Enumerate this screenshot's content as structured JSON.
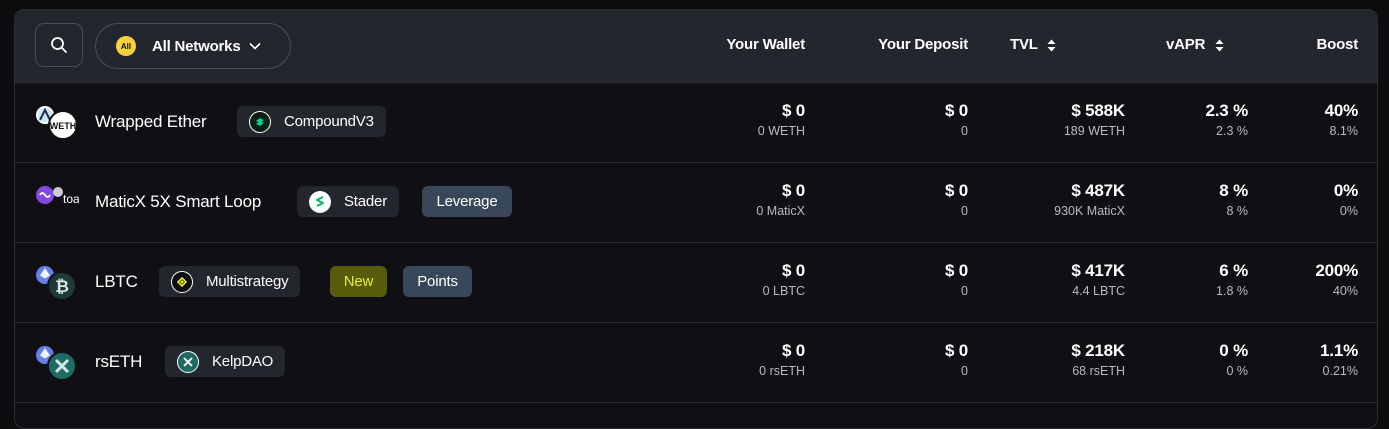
{
  "header": {
    "network_badge": "All",
    "network_label": "All Networks",
    "columns": {
      "wallet": "Your Wallet",
      "deposit": "Your Deposit",
      "tvl": "TVL",
      "vapr": "vAPR",
      "boost": "Boost"
    }
  },
  "rows": [
    {
      "name": "Wrapped Ether",
      "protocol": "CompoundV3",
      "token_badge": "WETH",
      "wallet_usd": "$ 0",
      "wallet_amt": "0 WETH",
      "deposit_usd": "$ 0",
      "deposit_amt": "0",
      "tvl_usd": "$ 588K",
      "tvl_amt": "189 WETH",
      "vapr": "2.3 %",
      "vapr_sub": "2.3 %",
      "boost": "40%",
      "boost_sub": "8.1%"
    },
    {
      "name": "MaticX 5X Smart Loop",
      "protocol": "Stader",
      "tag": "Leverage",
      "token_badge": "toa",
      "wallet_usd": "$ 0",
      "wallet_amt": "0 MaticX",
      "deposit_usd": "$ 0",
      "deposit_amt": "0",
      "tvl_usd": "$ 487K",
      "tvl_amt": "930K MaticX",
      "vapr": "8 %",
      "vapr_sub": "8 %",
      "boost": "0%",
      "boost_sub": "0%"
    },
    {
      "name": "LBTC",
      "protocol": "Multistrategy",
      "tag_new": "New",
      "tag": "Points",
      "wallet_usd": "$ 0",
      "wallet_amt": "0 LBTC",
      "deposit_usd": "$ 0",
      "deposit_amt": "0",
      "tvl_usd": "$ 417K",
      "tvl_amt": "4.4 LBTC",
      "vapr": "6 %",
      "vapr_sub": "1.8 %",
      "boost": "200%",
      "boost_sub": "40%"
    },
    {
      "name": "rsETH",
      "protocol": "KelpDAO",
      "wallet_usd": "$ 0",
      "wallet_amt": "0 rsETH",
      "deposit_usd": "$ 0",
      "deposit_amt": "0",
      "tvl_usd": "$ 218K",
      "tvl_amt": "68 rsETH",
      "vapr": "0 %",
      "vapr_sub": "0 %",
      "boost": "1.1%",
      "boost_sub": "0.21%"
    }
  ],
  "colors": {
    "header_bg": "#24262d",
    "row_bg": "#101014",
    "new_tag_bg": "#585a0c",
    "new_tag_text": "#e9ed35",
    "leverage_tag_bg": "#39475a",
    "network_dot": "#f7d23e"
  },
  "icons": [
    "search-icon",
    "chevron-down-icon",
    "sort-icon",
    "ethereum-icon",
    "weth-icon",
    "compound-icon",
    "polygon-icon",
    "stader-icon",
    "bitcoin-icon",
    "multistrategy-icon",
    "kelpdao-icon"
  ]
}
